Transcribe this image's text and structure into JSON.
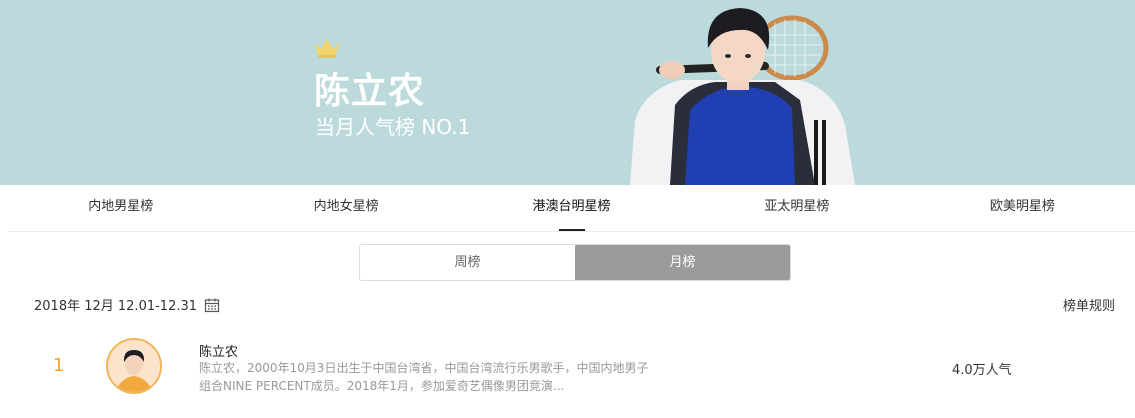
{
  "banner": {
    "star_name": "陈立农",
    "rank_text": "当月人气榜 NO.1",
    "accent_color": "#bcdadc",
    "crown_icon": "crown-icon"
  },
  "tabs": [
    {
      "label": "内地男星榜",
      "active": false
    },
    {
      "label": "内地女星榜",
      "active": false
    },
    {
      "label": "港澳台明星榜",
      "active": true
    },
    {
      "label": "亚太明星榜",
      "active": false
    },
    {
      "label": "欧美明星榜",
      "active": false
    }
  ],
  "segment": {
    "weekly": "周榜",
    "monthly": "月榜",
    "selected": "monthly"
  },
  "period": {
    "date_text": "2018年 12月 12.01-12.31",
    "calendar_icon": "calendar-icon",
    "rules_label": "榜单规则"
  },
  "ranking": [
    {
      "rank": "1",
      "name": "陈立农",
      "desc_line1": "陈立农，2000年10月3日出生于中国台湾省，中国台湾流行乐男歌手，中国内地男子",
      "desc_line2": "组合NINE PERCENT成员。2018年1月，参加爱奇艺偶像男团竞演...",
      "popularity": "4.0万人气"
    }
  ]
}
